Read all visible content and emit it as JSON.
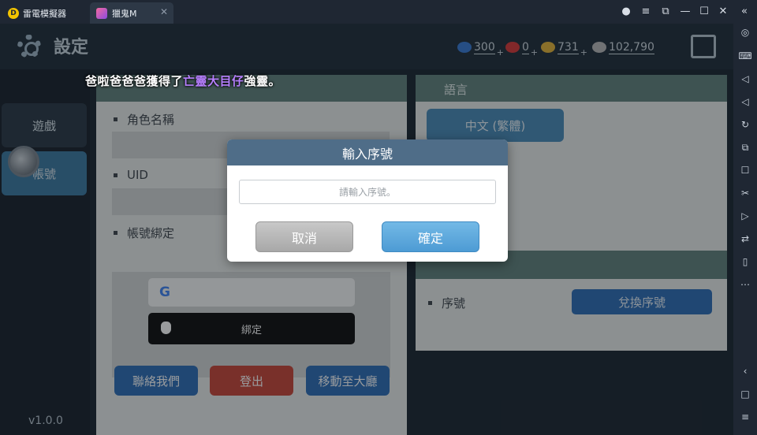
{
  "titlebar": {
    "tabs": [
      {
        "label": "雷電模擬器"
      },
      {
        "label": "獵鬼M"
      }
    ]
  },
  "header": {
    "title": "設定",
    "currencies": [
      {
        "icon": "blue-gem-icon",
        "value": "300",
        "color": "#3a7bd5"
      },
      {
        "icon": "red-gem-icon",
        "value": "0",
        "color": "#d83a3a"
      },
      {
        "icon": "gold-coin-icon",
        "value": "731",
        "color": "#e3b33a"
      },
      {
        "icon": "silver-coin-icon",
        "value": "102,790",
        "color": "#b8b8b8"
      }
    ],
    "currency_plus": "+"
  },
  "nav": {
    "items": [
      {
        "label": "遊戲"
      },
      {
        "label": "帳號"
      }
    ],
    "version": "v1.0.0"
  },
  "account_panel": {
    "character_name_label": "角色名稱",
    "uid_label": "UID",
    "binding_label": "帳號綁定",
    "bind_label": "綁定"
  },
  "actions": {
    "contact": "聯絡我們",
    "logout": "登出",
    "move_lobby": "移動至大廳"
  },
  "language_panel": {
    "title": "語言",
    "current": "中文 (繁體)"
  },
  "serial_panel": {
    "serial_label": "序號",
    "redeem_button": "兌換序號"
  },
  "toast": {
    "prefix": "爸啦爸爸爸獲得了",
    "highlight": "亡靈大目仔",
    "suffix": "強靈。"
  },
  "modal": {
    "title": "輸入序號",
    "placeholder": "請輸入序號。",
    "cancel": "取消",
    "confirm": "確定"
  }
}
